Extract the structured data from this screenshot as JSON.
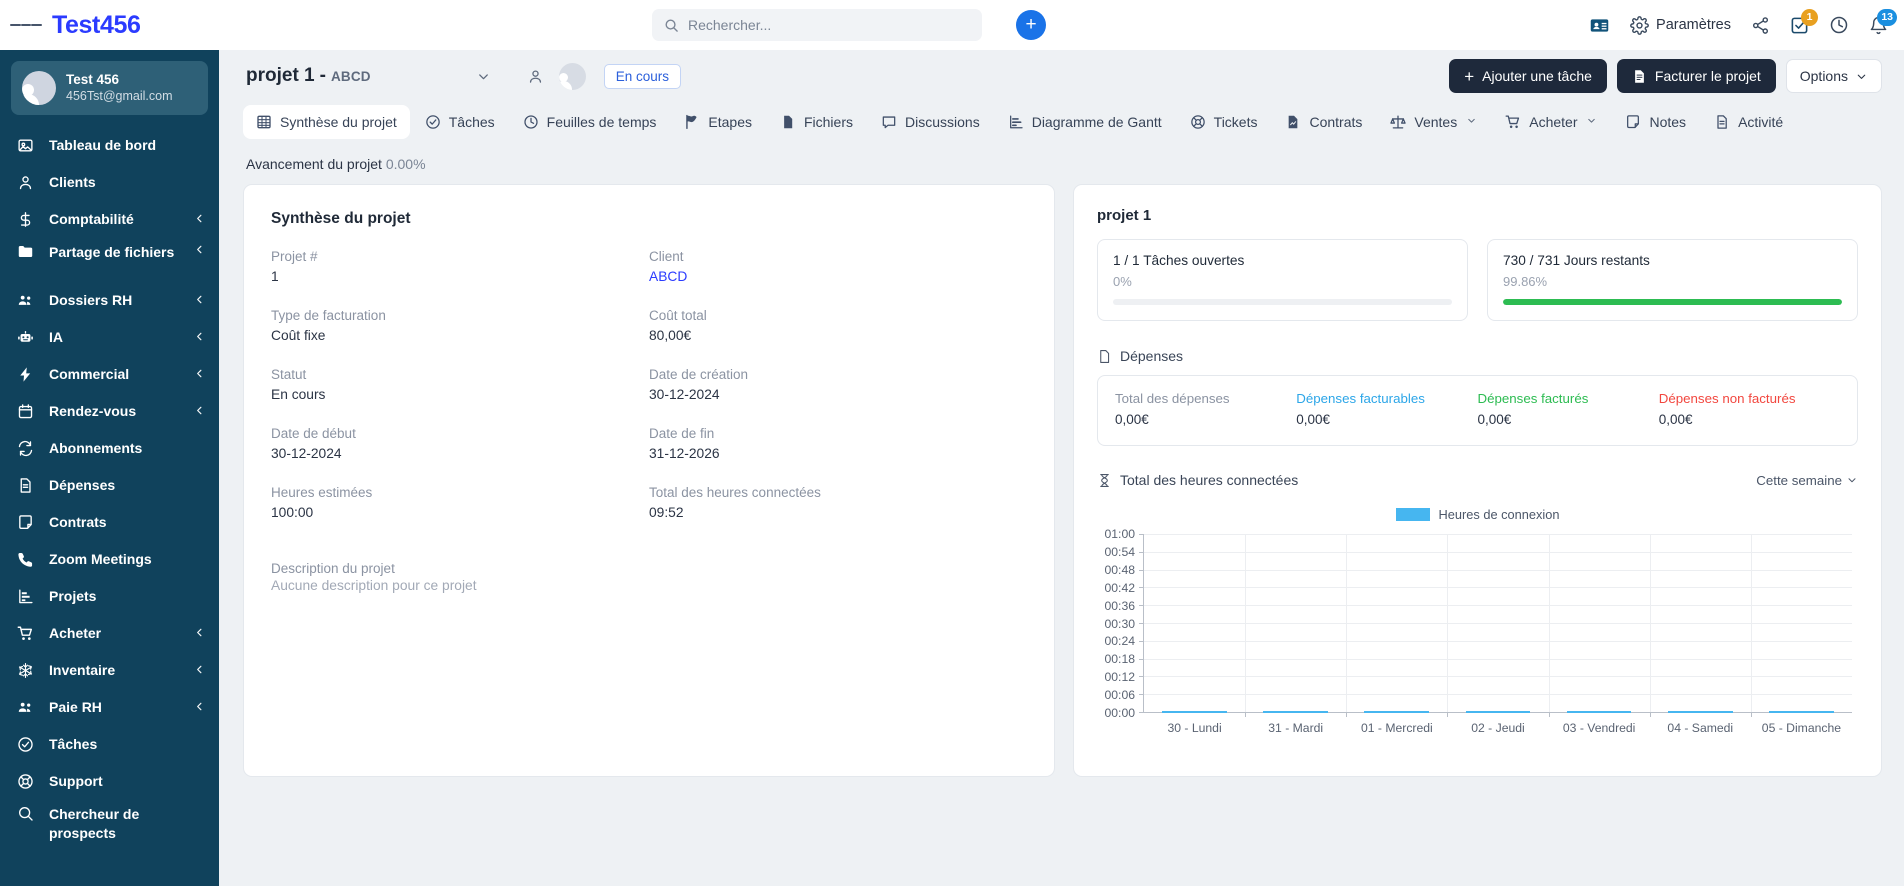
{
  "topbar": {
    "brand": "Test456",
    "menu_icon": "hamburger-icon",
    "search_placeholder": "Rechercher...",
    "search_value": "",
    "add_label": "+",
    "settings_label": "Paramètres",
    "tasks_badge": "1",
    "notifications_badge": "13"
  },
  "sidebar": {
    "profile": {
      "name": "Test 456",
      "email": "456Tst@gmail.com"
    },
    "items": [
      {
        "label": "Tableau de bord",
        "icon": "dashboard-icon",
        "expandable": false
      },
      {
        "label": "Clients",
        "icon": "user-icon",
        "expandable": false
      },
      {
        "label": "Comptabilité",
        "icon": "dollar-icon",
        "expandable": true
      },
      {
        "label": "Partage de fichiers",
        "icon": "folder-icon",
        "expandable": true
      },
      {
        "label": "Dossiers RH",
        "icon": "people-icon",
        "expandable": true
      },
      {
        "label": "IA",
        "icon": "robot-icon",
        "expandable": true
      },
      {
        "label": "Commercial",
        "icon": "bolt-icon",
        "expandable": true
      },
      {
        "label": "Rendez-vous",
        "icon": "calendar-icon",
        "expandable": true
      },
      {
        "label": "Abonnements",
        "icon": "refresh-icon",
        "expandable": false
      },
      {
        "label": "Dépenses",
        "icon": "document-icon",
        "expandable": false
      },
      {
        "label": "Contrats",
        "icon": "note-icon",
        "expandable": false
      },
      {
        "label": "Zoom Meetings",
        "icon": "phone-icon",
        "expandable": false
      },
      {
        "label": "Projets",
        "icon": "chart-icon",
        "expandable": false
      },
      {
        "label": "Acheter",
        "icon": "cart-icon",
        "expandable": true
      },
      {
        "label": "Inventaire",
        "icon": "snowflake-icon",
        "expandable": true
      },
      {
        "label": "Paie RH",
        "icon": "people-icon",
        "expandable": true
      },
      {
        "label": "Tâches",
        "icon": "check-circle-icon",
        "expandable": false
      },
      {
        "label": "Support",
        "icon": "lifebuoy-icon",
        "expandable": false
      },
      {
        "label": "Chercheur de prospects",
        "icon": "search-icon",
        "expandable": false
      }
    ]
  },
  "project": {
    "title": "projet 1",
    "subtitle": "ABCD",
    "status": "En cours",
    "add_task_label": "Ajouter une tâche",
    "invoice_label": "Facturer le projet",
    "options_label": "Options",
    "progress_label": "Avancement du projet",
    "progress_value": "0.00%"
  },
  "tabs": [
    {
      "label": "Synthèse du projet",
      "icon": "grid-icon",
      "active": true,
      "caret": false
    },
    {
      "label": "Tâches",
      "icon": "check-circle-icon",
      "active": false,
      "caret": false
    },
    {
      "label": "Feuilles de temps",
      "icon": "clock-icon",
      "active": false,
      "caret": false
    },
    {
      "label": "Etapes",
      "icon": "flag-icon",
      "active": false,
      "caret": false
    },
    {
      "label": "Fichiers",
      "icon": "file-icon",
      "active": false,
      "caret": false
    },
    {
      "label": "Discussions",
      "icon": "chat-icon",
      "active": false,
      "caret": false
    },
    {
      "label": "Diagramme de Gantt",
      "icon": "gantt-icon",
      "active": false,
      "caret": false
    },
    {
      "label": "Tickets",
      "icon": "lifebuoy-icon",
      "active": false,
      "caret": false
    },
    {
      "label": "Contrats",
      "icon": "contract-icon",
      "active": false,
      "caret": false
    },
    {
      "label": "Ventes",
      "icon": "scale-icon",
      "active": false,
      "caret": true
    },
    {
      "label": "Acheter",
      "icon": "cart-icon",
      "active": false,
      "caret": true
    },
    {
      "label": "Notes",
      "icon": "note-icon",
      "active": false,
      "caret": false
    },
    {
      "label": "Activité",
      "icon": "activity-icon",
      "active": false,
      "caret": false
    }
  ],
  "summary": {
    "heading": "Synthèse du projet",
    "fields": [
      {
        "label": "Projet #",
        "value": "1",
        "link": false
      },
      {
        "label": "Client",
        "value": "ABCD",
        "link": true
      },
      {
        "label": "Type de facturation",
        "value": "Coût fixe",
        "link": false
      },
      {
        "label": "Coût total",
        "value": "80,00€",
        "link": false
      },
      {
        "label": "Statut",
        "value": "En cours",
        "link": false
      },
      {
        "label": "Date de création",
        "value": "30-12-2024",
        "link": false
      },
      {
        "label": "Date de début",
        "value": "30-12-2024",
        "link": false
      },
      {
        "label": "Date de fin",
        "value": "31-12-2026",
        "link": false
      },
      {
        "label": "Heures estimées",
        "value": "100:00",
        "link": false
      },
      {
        "label": "Total des heures connectées",
        "value": "09:52",
        "link": false
      }
    ],
    "description_label": "Description du projet",
    "description_value": "Aucune description pour ce projet"
  },
  "right": {
    "title": "projet 1",
    "stats": [
      {
        "title": "1 / 1 Tâches ouvertes",
        "pct_label": "0%",
        "pct": 0,
        "color": "#efefef"
      },
      {
        "title": "730 / 731 Jours restants",
        "pct_label": "99.86%",
        "pct": 99.86,
        "color": "#2dbc52"
      }
    ],
    "expenses": {
      "section_label": "Dépenses",
      "columns": [
        {
          "label": "Total des dépenses",
          "value": "0,00€",
          "color": "#8b93a2"
        },
        {
          "label": "Dépenses facturables",
          "value": "0,00€",
          "color": "#2ca6e8"
        },
        {
          "label": "Dépenses facturés",
          "value": "0,00€",
          "color": "#2dbc52"
        },
        {
          "label": "Dépenses non facturés",
          "value": "0,00€",
          "color": "#f2473f"
        }
      ]
    },
    "chart_section_label": "Total des heures connectées",
    "range_label": "Cette semaine"
  },
  "chart_data": {
    "type": "bar",
    "title": "Total des heures connectées",
    "legend": [
      "Heures de connexion"
    ],
    "legend_position": "top-center",
    "series": [
      {
        "name": "Heures de connexion",
        "color": "#46b6f0",
        "values": [
          0,
          0,
          0,
          0,
          0,
          0,
          0
        ]
      }
    ],
    "categories": [
      "30 - Lundi",
      "31 - Mardi",
      "01 - Mercredi",
      "02 - Jeudi",
      "03 - Vendredi",
      "04 - Samedi",
      "05 - Dimanche"
    ],
    "ytick_labels": [
      "01:00",
      "00:54",
      "00:48",
      "00:42",
      "00:36",
      "00:30",
      "00:24",
      "00:18",
      "00:12",
      "00:06",
      "00:00"
    ],
    "ylim": [
      0,
      60
    ],
    "ylabel": "",
    "xlabel": "",
    "grid": true
  }
}
